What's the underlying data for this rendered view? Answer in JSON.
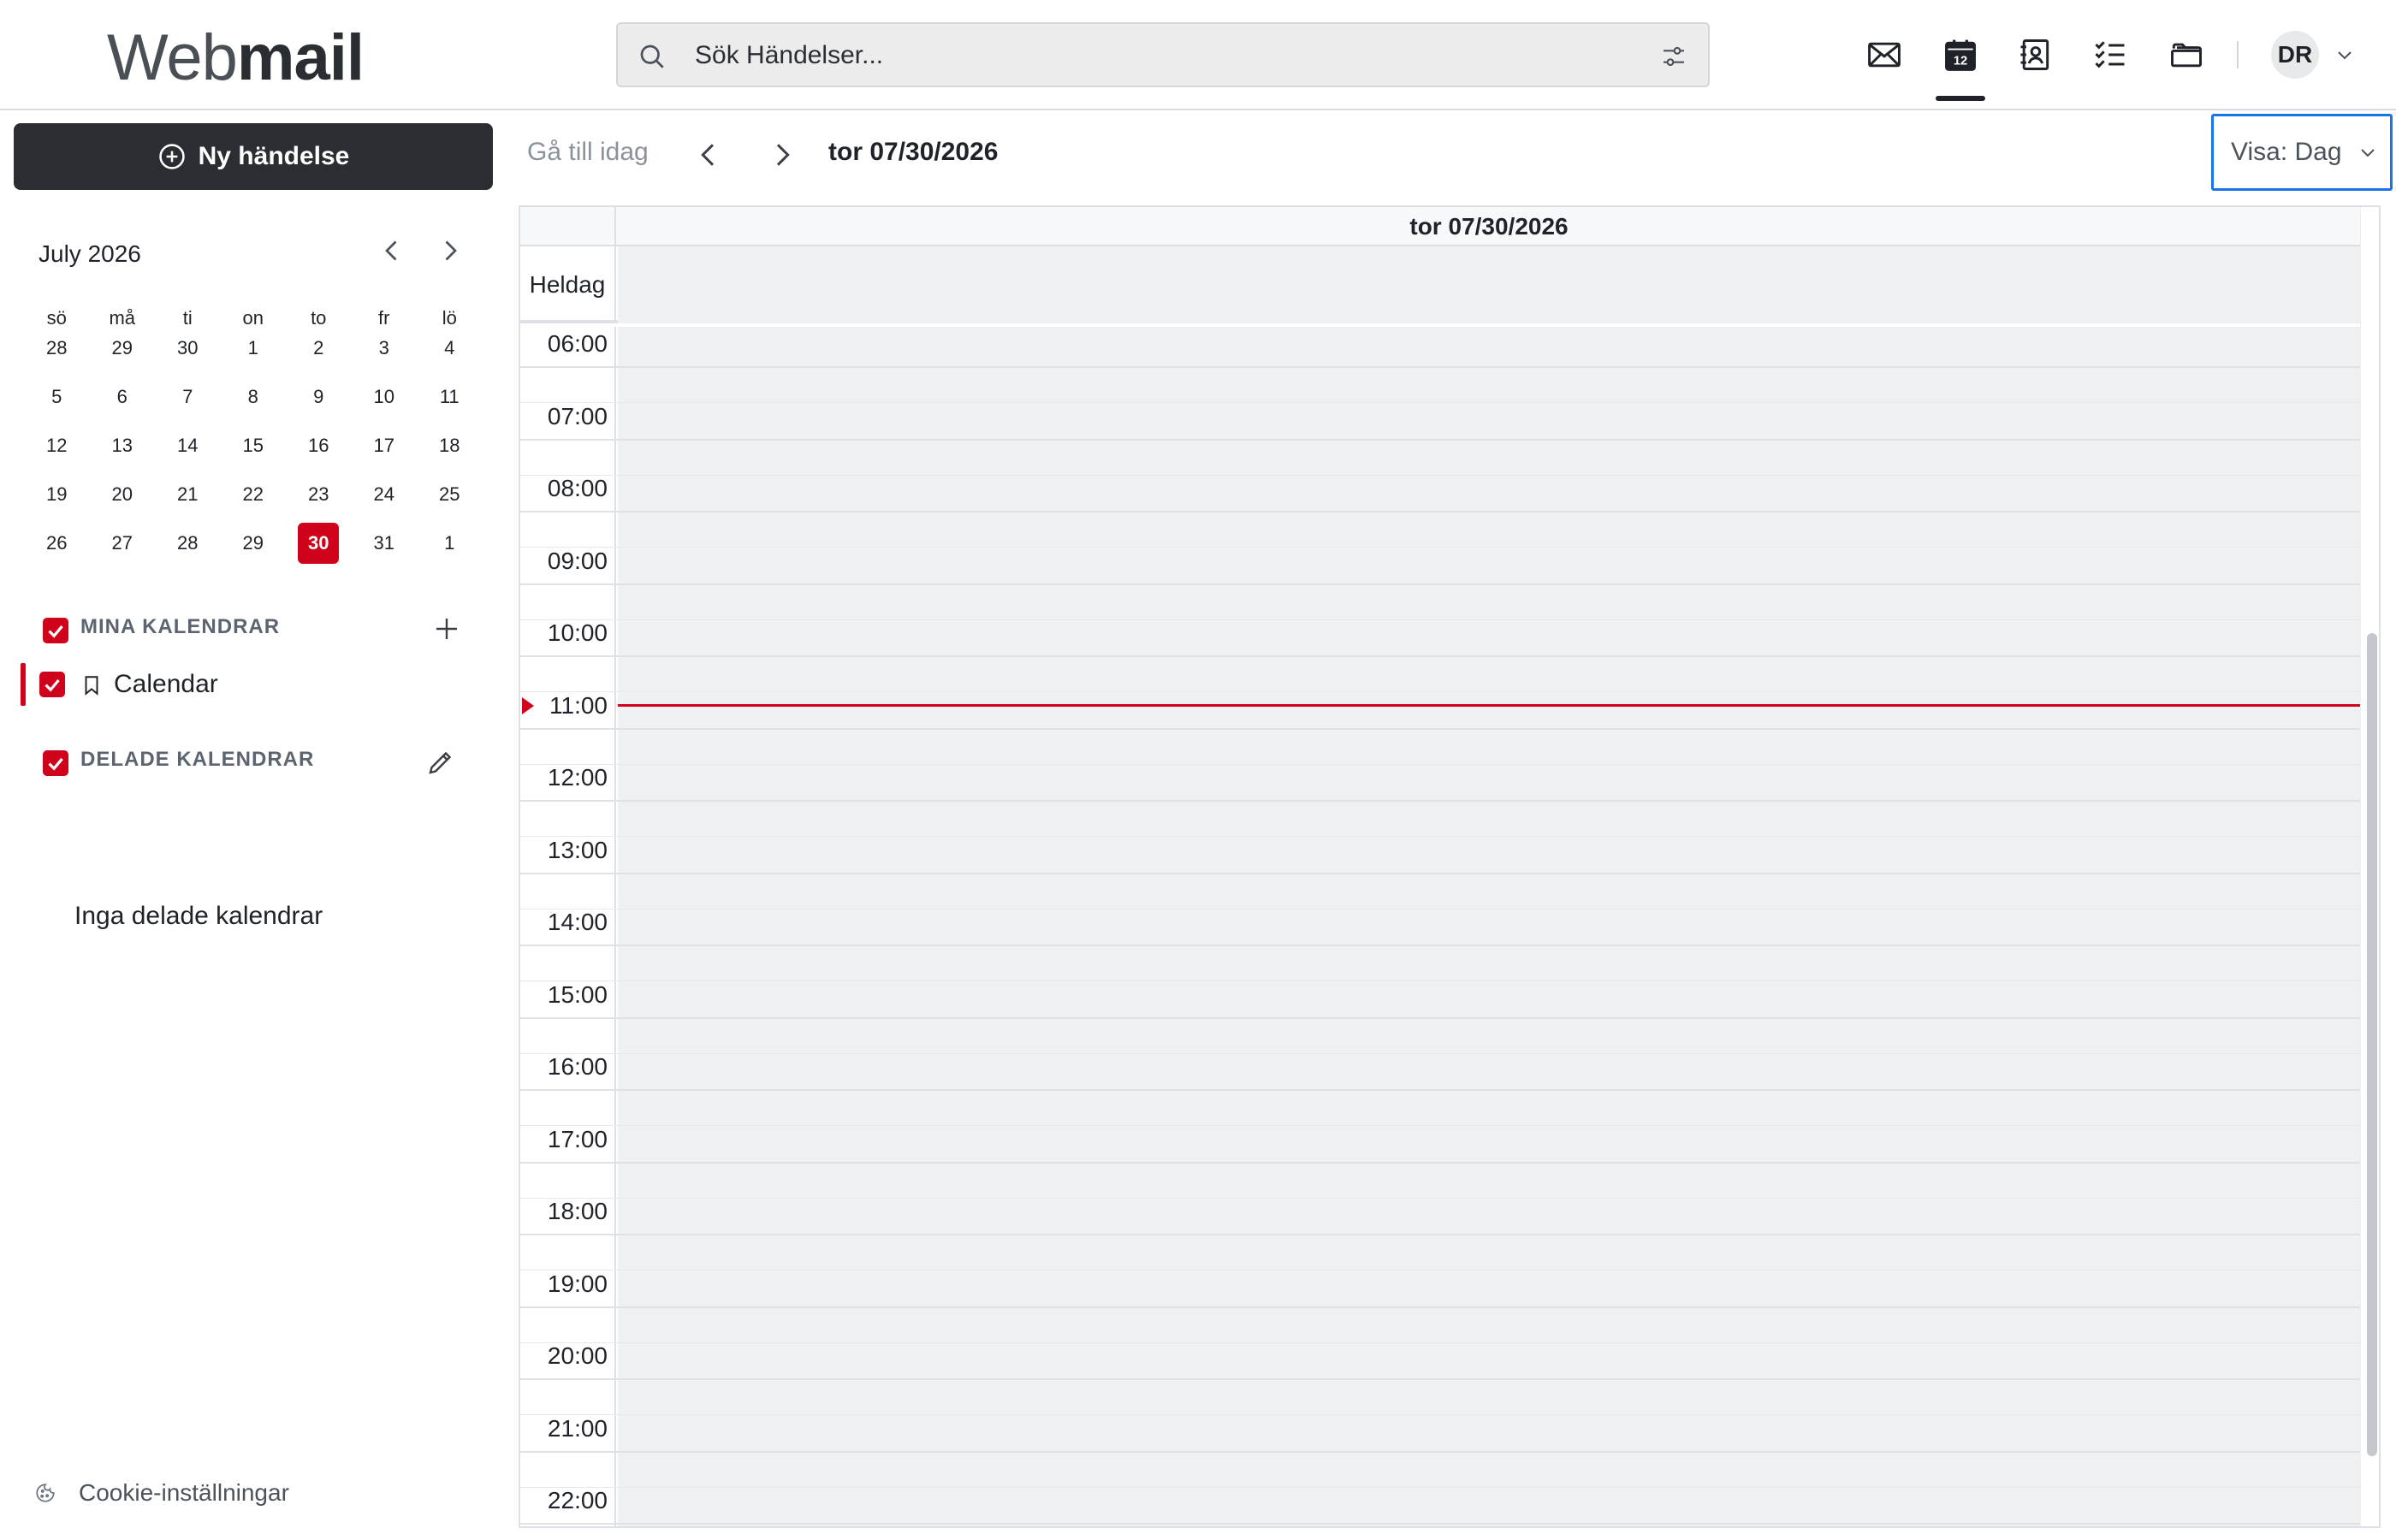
{
  "header": {
    "logo_light": "Web",
    "logo_bold": "mail",
    "search_placeholder": "Sök Händelser...",
    "nav_icons": [
      "mail-icon",
      "calendar-icon",
      "contacts-icon",
      "tasks-icon",
      "files-icon"
    ],
    "calendar_icon_day": "12",
    "avatar_initials": "DR"
  },
  "sidebar": {
    "new_event_label": "Ny händelse",
    "mini_calendar": {
      "title": "July 2026",
      "weekdays": [
        "sö",
        "må",
        "ti",
        "on",
        "to",
        "fr",
        "lö"
      ],
      "weeks": [
        [
          "28",
          "29",
          "30",
          "1",
          "2",
          "3",
          "4"
        ],
        [
          "5",
          "6",
          "7",
          "8",
          "9",
          "10",
          "11"
        ],
        [
          "12",
          "13",
          "14",
          "15",
          "16",
          "17",
          "18"
        ],
        [
          "19",
          "20",
          "21",
          "22",
          "23",
          "24",
          "25"
        ],
        [
          "26",
          "27",
          "28",
          "29",
          "30",
          "31",
          "1"
        ]
      ],
      "selected_day": "30"
    },
    "my_calendars": {
      "label": "MINA KALENDRAR",
      "checked": true,
      "items": [
        {
          "name": "Calendar",
          "checked": true,
          "color": "#d0021b"
        }
      ]
    },
    "shared_calendars": {
      "label": "DELADE KALENDRAR",
      "checked": true,
      "empty_text": "Inga delade kalendrar"
    },
    "cookie_settings_label": "Cookie-inställningar"
  },
  "toolbar": {
    "go_to_today": "Gå till idag",
    "current_date": "tor 07/30/2026",
    "view_select": "Visa: Dag"
  },
  "day_view": {
    "day_title": "tor 07/30/2026",
    "all_day_label": "Heldag",
    "hours": [
      "06:00",
      "07:00",
      "08:00",
      "09:00",
      "10:00",
      "11:00",
      "12:00",
      "13:00",
      "14:00",
      "15:00",
      "16:00",
      "17:00",
      "18:00",
      "19:00",
      "20:00",
      "21:00",
      "22:00"
    ],
    "current_time_hour": "11:00"
  },
  "colors": {
    "accent_red": "#d0021b",
    "primary_button": "#2a2d32",
    "focus_blue": "#1a73e8"
  }
}
